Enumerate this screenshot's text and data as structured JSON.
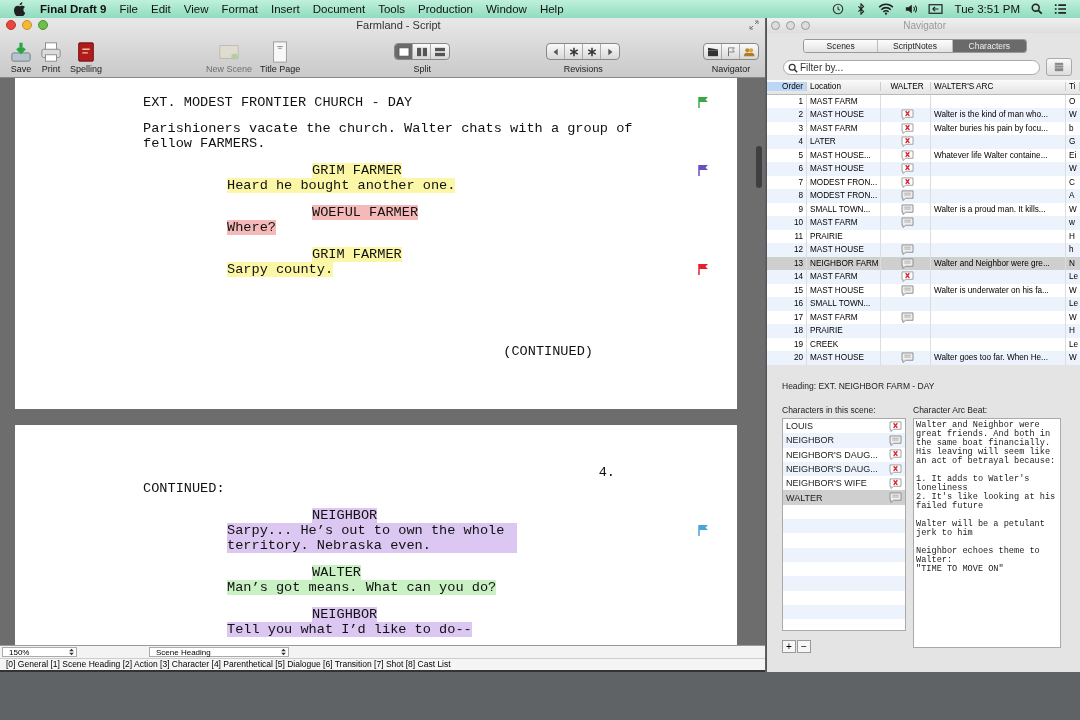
{
  "menubar": {
    "app": "Final Draft 9",
    "menus": [
      "File",
      "Edit",
      "View",
      "Format",
      "Insert",
      "Document",
      "Tools",
      "Production",
      "Window",
      "Help"
    ],
    "clock": "Tue 3:51 PM"
  },
  "window": {
    "title": "Farmland - Script"
  },
  "toolbar": {
    "buttons": [
      {
        "kind": "save",
        "label": "Save",
        "disabled": false
      },
      {
        "kind": "print",
        "label": "Print",
        "disabled": false
      },
      {
        "kind": "spelling",
        "label": "Spelling",
        "disabled": false
      },
      {
        "kind": "new_scene",
        "label": "New Scene",
        "disabled": true
      },
      {
        "kind": "title_page",
        "label": "Title Page",
        "disabled": false
      }
    ],
    "split": {
      "label": "Split",
      "segments": [
        {
          "kind": "single",
          "selected": true
        },
        {
          "kind": "columns",
          "selected": false
        },
        {
          "kind": "rows",
          "selected": false
        }
      ]
    },
    "revisions": {
      "label": "Revisions"
    },
    "navigator": {
      "label": "Navigator"
    }
  },
  "pages": [
    {
      "elements": [
        {
          "kind": "heading",
          "text": "EXT. MODEST FRONTIER CHURCH - DAY",
          "flag": {
            "color": "#3aa845"
          }
        },
        {
          "kind": "action",
          "text": "Parishioners vacate the church. Walter chats with a group of fellow FARMERS."
        },
        {
          "kind": "character",
          "text": "GRIM FARMER",
          "color": "#fbf7a6",
          "flag": {
            "color": "#6a4fc0"
          }
        },
        {
          "kind": "dialogue",
          "text": "Heard he bought another one.",
          "color": "#fbf7a6"
        },
        {
          "kind": "character",
          "text": "WOEFUL FARMER",
          "color": "#f5b9b9"
        },
        {
          "kind": "dialogue",
          "text": "Where?",
          "color": "#f5b9b9"
        },
        {
          "kind": "character",
          "text": "GRIM FARMER",
          "color": "#fbf7a6"
        },
        {
          "kind": "dialogue",
          "text": "Sarpy county.",
          "color": "#fbf7a6",
          "flag": {
            "color": "#e8202a"
          }
        },
        {
          "kind": "more",
          "text": "(CONTINUED)"
        }
      ]
    },
    {
      "elements": [
        {
          "kind": "page_number",
          "text": "4."
        },
        {
          "kind": "continued",
          "text": "CONTINUED:"
        },
        {
          "kind": "character",
          "text": "NEIGHBOR",
          "color": "#dcc6f2"
        },
        {
          "kind": "dialogue",
          "text": "Sarpy... He’s out to own the whole territory. Nebraska even.",
          "color": "#dcc6f2",
          "flag": {
            "color": "#4aa3df"
          }
        },
        {
          "kind": "character",
          "text": "WALTER",
          "color": "#c9f1c4"
        },
        {
          "kind": "dialogue",
          "text": "Man’s got means. What can you do?",
          "color": "#c9f1c4"
        },
        {
          "kind": "character",
          "text": "NEIGHBOR",
          "color": "#dcc6f2"
        },
        {
          "kind": "dialogue",
          "text": "Tell you what I’d like to do--",
          "color": "#dcc6f2"
        }
      ]
    }
  ],
  "zoom": {
    "value": "150%",
    "element": "Scene Heading"
  },
  "status_bar": "[0] General [1] Scene Heading [2] Action [3] Character [4] Parenthetical [5] Dialogue [6] Transition [7] Shot [8] Cast List",
  "navigator": {
    "title": "Navigator",
    "tabs": [
      {
        "label": "Scenes",
        "selected": false
      },
      {
        "label": "ScriptNotes",
        "selected": false
      },
      {
        "label": "Characters",
        "selected": true
      }
    ],
    "filter": {
      "placeholder": "Filter by..."
    },
    "table": {
      "columns": [
        "Order",
        "Location",
        "WALTER",
        "WALTER'S ARC",
        "Ti"
      ],
      "rows": [
        {
          "order": "1",
          "location": "MAST FARM",
          "kind": "blank",
          "arc": "",
          "column_5": "O",
          "selected": false
        },
        {
          "order": "2",
          "location": "MAST HOUSE",
          "kind": "x",
          "arc": "Walter is the kind of man who...",
          "column_5": "W",
          "selected": false
        },
        {
          "order": "3",
          "location": "MAST FARM",
          "kind": "x",
          "arc": "Walter buries his pain by focu...",
          "column_5": "b",
          "selected": false
        },
        {
          "order": "4",
          "location": "LATER",
          "kind": "x",
          "arc": "",
          "column_5": "G",
          "selected": false
        },
        {
          "order": "5",
          "location": "MAST HOUSE...",
          "kind": "x",
          "arc": "Whatever life Walter containe...",
          "column_5": "Ei",
          "selected": false
        },
        {
          "order": "6",
          "location": "MAST HOUSE",
          "kind": "x",
          "arc": "",
          "column_5": "W",
          "selected": false
        },
        {
          "order": "7",
          "location": "MODEST FRON...",
          "kind": "x",
          "arc": "",
          "column_5": "C",
          "selected": false
        },
        {
          "order": "8",
          "location": "MODEST FRON...",
          "kind": "note",
          "arc": "",
          "column_5": "A",
          "selected": false
        },
        {
          "order": "9",
          "location": "SMALL TOWN...",
          "kind": "note",
          "arc": "Walter is a proud man. It kills...",
          "column_5": "W",
          "selected": false
        },
        {
          "order": "10",
          "location": "MAST FARM",
          "kind": "note",
          "arc": "",
          "column_5": "w",
          "selected": false
        },
        {
          "order": "11",
          "location": "PRAIRIE",
          "kind": "blank",
          "arc": "",
          "column_5": "H",
          "selected": false
        },
        {
          "order": "12",
          "location": "MAST HOUSE",
          "kind": "note",
          "arc": "",
          "column_5": "h",
          "selected": false
        },
        {
          "order": "13",
          "location": "NEIGHBOR FARM",
          "kind": "note",
          "arc": "Walter and Neighbor were gre...",
          "column_5": "N",
          "selected": true
        },
        {
          "order": "14",
          "location": "MAST FARM",
          "kind": "x",
          "arc": "",
          "column_5": "Le",
          "selected": false
        },
        {
          "order": "15",
          "location": "MAST HOUSE",
          "kind": "note",
          "arc": "Walter is underwater on his fa...",
          "column_5": "W",
          "selected": false
        },
        {
          "order": "16",
          "location": "SMALL TOWN...",
          "kind": "blank",
          "arc": "",
          "column_5": "Le",
          "selected": false
        },
        {
          "order": "17",
          "location": "MAST FARM",
          "kind": "note",
          "arc": "",
          "column_5": "W",
          "selected": false
        },
        {
          "order": "18",
          "location": "PRAIRIE",
          "kind": "blank",
          "arc": "",
          "column_5": "H",
          "selected": false
        },
        {
          "order": "19",
          "location": "CREEK",
          "kind": "blank",
          "arc": "",
          "column_5": "Le",
          "selected": false
        },
        {
          "order": "20",
          "location": "MAST HOUSE",
          "kind": "note",
          "arc": "Walter goes too far. When He...",
          "column_5": "W",
          "selected": false
        }
      ]
    },
    "heading": "Heading:  EXT. NEIGHBOR FARM - DAY",
    "characters_label": "Characters in this scene:",
    "characters": [
      {
        "name": "LOUIS",
        "kind": "x",
        "selected": false
      },
      {
        "name": "NEIGHBOR",
        "kind": "note",
        "selected": false
      },
      {
        "name": "NEIGHBOR'S DAUG...",
        "kind": "x",
        "selected": false
      },
      {
        "name": "NEIGHBOR'S DAUG...",
        "kind": "x",
        "selected": false
      },
      {
        "name": "NEIGHBOR'S WIFE",
        "kind": "x",
        "selected": false
      },
      {
        "name": "WALTER",
        "kind": "note",
        "selected": true
      }
    ],
    "add_button": "+",
    "remove_button": "−",
    "arc_label": "Character Arc Beat:",
    "arc_text": "Walter and Neighbor were\ngreat friends. And both in\nthe same boat financially.\nHis leaving will seem like\nan act of betrayal because:\n\n1. It adds to Watler's\nloneliness\n2. It's like looking at his\nfailed future\n\nWalter will be a petulant\njerk to him\n\nNeighbor echoes theme to\nWalter:\n\"TIME TO MOVE ON\""
  }
}
